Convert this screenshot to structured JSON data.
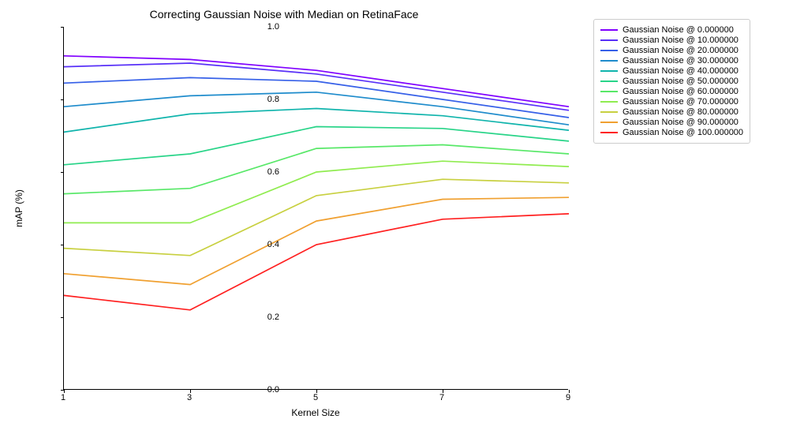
{
  "chart_data": {
    "type": "line",
    "title": "Correcting Gaussian Noise with Median on RetinaFace",
    "xlabel": "Kernel Size",
    "ylabel": "mAP (%)",
    "ylim": [
      0.0,
      1.0
    ],
    "yticks": [
      0.0,
      0.2,
      0.4,
      0.6,
      0.8,
      1.0
    ],
    "x": [
      1,
      3,
      5,
      7,
      9
    ],
    "series": [
      {
        "name": "Gaussian Noise @ 0.000000",
        "color": "#8000ff",
        "values": [
          0.92,
          0.91,
          0.88,
          0.83,
          0.78
        ]
      },
      {
        "name": "Gaussian Noise @ 10.000000",
        "color": "#5830f8",
        "values": [
          0.89,
          0.9,
          0.87,
          0.82,
          0.77
        ]
      },
      {
        "name": "Gaussian Noise @ 20.000000",
        "color": "#3660e8",
        "values": [
          0.845,
          0.86,
          0.85,
          0.8,
          0.75
        ]
      },
      {
        "name": "Gaussian Noise @ 30.000000",
        "color": "#1f8ccc",
        "values": [
          0.78,
          0.81,
          0.82,
          0.78,
          0.73
        ]
      },
      {
        "name": "Gaussian Noise @ 40.000000",
        "color": "#10b4ac",
        "values": [
          0.71,
          0.76,
          0.775,
          0.755,
          0.715
        ]
      },
      {
        "name": "Gaussian Noise @ 50.000000",
        "color": "#28d488",
        "values": [
          0.62,
          0.65,
          0.725,
          0.72,
          0.685
        ]
      },
      {
        "name": "Gaussian Noise @ 60.000000",
        "color": "#58e868",
        "values": [
          0.54,
          0.555,
          0.665,
          0.675,
          0.65
        ]
      },
      {
        "name": "Gaussian Noise @ 70.000000",
        "color": "#90ec50",
        "values": [
          0.46,
          0.46,
          0.6,
          0.63,
          0.615
        ]
      },
      {
        "name": "Gaussian Noise @ 80.000000",
        "color": "#c8d040",
        "values": [
          0.39,
          0.37,
          0.535,
          0.58,
          0.57
        ]
      },
      {
        "name": "Gaussian Noise @ 90.000000",
        "color": "#f0a030",
        "values": [
          0.32,
          0.29,
          0.465,
          0.525,
          0.53
        ]
      },
      {
        "name": "Gaussian Noise @ 100.000000",
        "color": "#ff2020",
        "values": [
          0.26,
          0.22,
          0.4,
          0.47,
          0.485
        ]
      }
    ]
  }
}
